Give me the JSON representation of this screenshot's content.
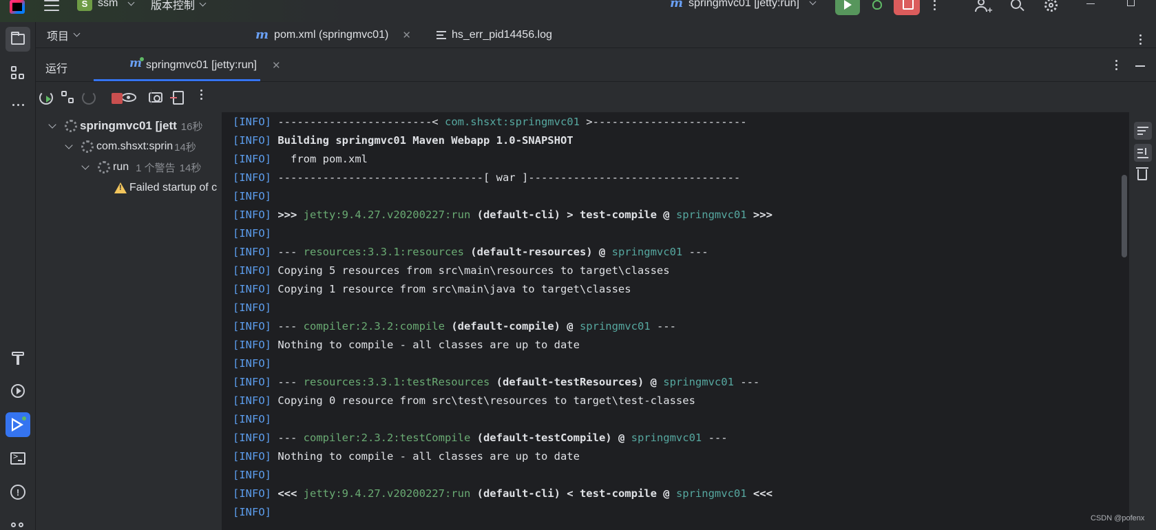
{
  "titlebar": {
    "project_badge": "S",
    "project_name": "ssm",
    "vcs_label": "版本控制",
    "run_config": "springmvc01 [jetty:run]",
    "icons": [
      "app-logo",
      "hamburger-icon",
      "run-icon",
      "debug-icon",
      "stop-icon",
      "more-icon",
      "add-user-icon",
      "search-icon",
      "settings-icon",
      "minimize-icon",
      "maximize-icon"
    ]
  },
  "left_toolbar": {
    "items": [
      "project-icon",
      "structure-icon",
      "more-tools-icon",
      "build-icon",
      "services-icon",
      "run-icon",
      "terminal-icon",
      "problems-icon",
      "vcs-icon"
    ]
  },
  "project_panel": {
    "label": "项目"
  },
  "editor_tabs": [
    {
      "icon": "m",
      "label": "pom.xml (springmvc01)",
      "closable": true
    },
    {
      "icon": "log",
      "label": "hs_err_pid14456.log",
      "closable": false
    }
  ],
  "run_window": {
    "title": "运行",
    "tab_label": "springmvc01 [jetty:run]",
    "toolbar_icons": [
      "rerun-icon",
      "toggle-tests-icon",
      "rerun-failed-icon",
      "stop-icon",
      "eye-icon",
      "camera-icon",
      "import-icon",
      "more-icon"
    ]
  },
  "tree": [
    {
      "label": "springmvc01 [jett",
      "duration": "16秒"
    },
    {
      "label": "com.shsxt:sprin",
      "duration": "14秒"
    },
    {
      "label": "run",
      "note": "1 个警告",
      "duration": "14秒"
    },
    {
      "label": "Failed startup of c"
    }
  ],
  "console_lines": [
    "[INFO] ------------------------< com.shsxt:springmvc01 >------------------------",
    "[INFO] Building springmvc01 Maven Webapp 1.0-SNAPSHOT",
    "[INFO]   from pom.xml",
    "[INFO] --------------------------------[ war ]---------------------------------",
    "[INFO]",
    "[INFO] >>> jetty:9.4.27.v20200227:run (default-cli) > test-compile @ springmvc01 >>>",
    "[INFO]",
    "[INFO] --- resources:3.3.1:resources (default-resources) @ springmvc01 ---",
    "[INFO] Copying 5 resources from src\\main\\resources to target\\classes",
    "[INFO] Copying 1 resource from src\\main\\java to target\\classes",
    "[INFO]",
    "[INFO] --- compiler:2.3.2:compile (default-compile) @ springmvc01 ---",
    "[INFO] Nothing to compile - all classes are up to date",
    "[INFO]",
    "[INFO] --- resources:3.3.1:testResources (default-testResources) @ springmvc01 ---",
    "[INFO] Copying 0 resource from src\\test\\resources to target\\test-classes",
    "[INFO]",
    "[INFO] --- compiler:2.3.2:testCompile (default-testCompile) @ springmvc01 ---",
    "[INFO] Nothing to compile - all classes are up to date",
    "[INFO]",
    "[INFO] <<< jetty:9.4.27.v20200227:run (default-cli) < test-compile @ springmvc01 <<<",
    "[INFO]"
  ],
  "console": {
    "level": "[INFO]",
    "l1_pre": "------------------------< ",
    "l1_artifact": "com.shsxt:springmvc01",
    "l1_post": " >------------------------",
    "l2": "Building springmvc01 Maven Webapp 1.0-SNAPSHOT",
    "l3": "  from pom.xml",
    "l4": "--------------------------------[ war ]---------------------------------",
    "l6_pre": ">>> ",
    "l6_goal": "jetty:9.4.27.v20200227:run",
    "l6_mid": " (default-cli) > test-compile @ ",
    "l6_proj": "springmvc01",
    "l6_post": " >>>",
    "l8_pre": "--- ",
    "l8_goal": "resources:3.3.1:resources",
    "l8_mid": " (default-resources) @ ",
    "l8_proj": "springmvc01",
    "l8_post": " ---",
    "l9": "Copying 5 resources from src\\main\\resources to target\\classes",
    "l10": "Copying 1 resource from src\\main\\java to target\\classes",
    "l12_pre": "--- ",
    "l12_goal": "compiler:2.3.2:compile",
    "l12_mid": " (default-compile) @ ",
    "l12_proj": "springmvc01",
    "l12_post": " ---",
    "l13": "Nothing to compile - all classes are up to date",
    "l15_pre": "--- ",
    "l15_goal": "resources:3.3.1:testResources",
    "l15_mid": " (default-testResources) @ ",
    "l15_proj": "springmvc01",
    "l15_post": " ---",
    "l16": "Copying 0 resource from src\\test\\resources to target\\test-classes",
    "l18_pre": "--- ",
    "l18_goal": "compiler:2.3.2:testCompile",
    "l18_mid": " (default-testCompile) @ ",
    "l18_proj": "springmvc01",
    "l18_post": " ---",
    "l19": "Nothing to compile - all classes are up to date",
    "l21_pre": "<<< ",
    "l21_goal": "jetty:9.4.27.v20200227:run",
    "l21_mid": " (default-cli) < test-compile @ ",
    "l21_proj": "springmvc01",
    "l21_post": " <<<"
  },
  "console_actions": [
    "soft-wrap-icon",
    "scroll-to-end-icon",
    "clear-icon"
  ],
  "watermark": "CSDN @pofenx",
  "colors": {
    "background": "#1e1f22",
    "panel": "#2b2d30",
    "accent": "#3574f0",
    "run_green": "#57965c",
    "stop_red": "#db5c5c",
    "info_blue": "#5c9ded",
    "goal_green": "#6aab73",
    "artifact_teal": "#56a8a0"
  }
}
